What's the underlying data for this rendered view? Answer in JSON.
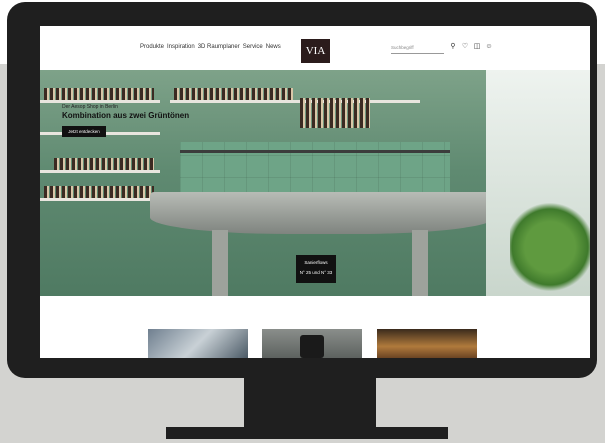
{
  "colors": {
    "monitor_bezel": "#1f1f1f",
    "background_band": "#d3d3d0",
    "logo_bg": "#2b1c1c",
    "hero_green": "#5f8a71"
  },
  "header": {
    "nav": [
      "Produkte",
      "Inspiration",
      "3D Raumplaner",
      "Service",
      "News"
    ],
    "logo": "VIA",
    "search_placeholder": "Suchbegriff",
    "icons": [
      "search-icon",
      "heart-icon",
      "bag-icon",
      "user-icon"
    ]
  },
  "hero": {
    "eyebrow": "Der Aesop Shop in Berlin",
    "title": "Kombination aus zwei Grüntönen",
    "cta": "Jetzt entdecken",
    "panel_title": "Sanierflows",
    "panel_sub": "N° 25 und N° 33"
  },
  "thumbnails": [
    "marble-thumbnail",
    "device-thumbnail",
    "interior-thumbnail"
  ]
}
